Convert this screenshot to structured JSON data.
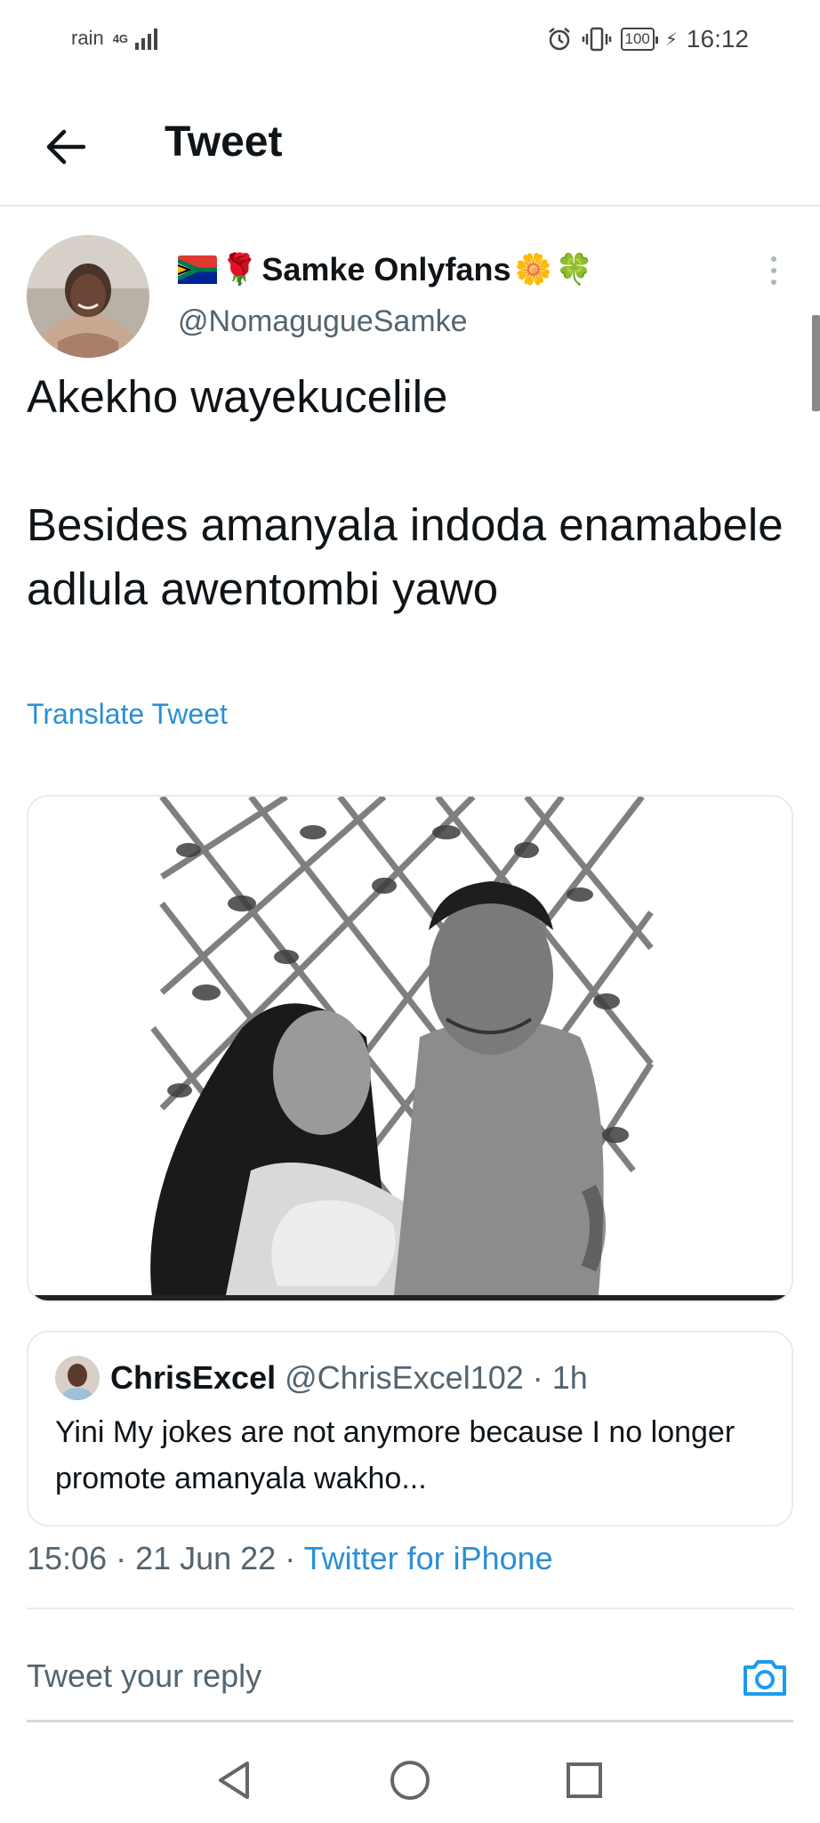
{
  "status_bar": {
    "carrier": "rain",
    "network": "4G",
    "battery": "100",
    "time": "16:12"
  },
  "header": {
    "title": "Tweet"
  },
  "tweet": {
    "display_name": "Samke Onlyfans",
    "handle": "@NomagugueSamke",
    "text": "Akekho wayekucelile\n\nBesides amanyala indoda enamabele adlula awentombi yawo",
    "translate_label": "Translate Tweet",
    "timestamp": "15:06 · 21 Jun 22 · ",
    "source": "Twitter for iPhone"
  },
  "quote": {
    "name": "ChrisExcel",
    "handle_time": " @ChrisExcel102 · 1h",
    "text": "Yini My jokes are not anymore because I no longer promote amanyala wakho..."
  },
  "reply": {
    "placeholder": "Tweet your reply"
  },
  "colors": {
    "accent": "#1d9bf0",
    "secondary_text": "#536471",
    "divider": "#e6ecf0"
  },
  "icons": [
    "back-arrow-icon",
    "more-vertical-icon",
    "camera-icon",
    "nav-back-icon",
    "nav-home-icon",
    "nav-recents-icon",
    "alarm-icon",
    "vibrate-icon",
    "battery-icon",
    "charging-icon"
  ]
}
